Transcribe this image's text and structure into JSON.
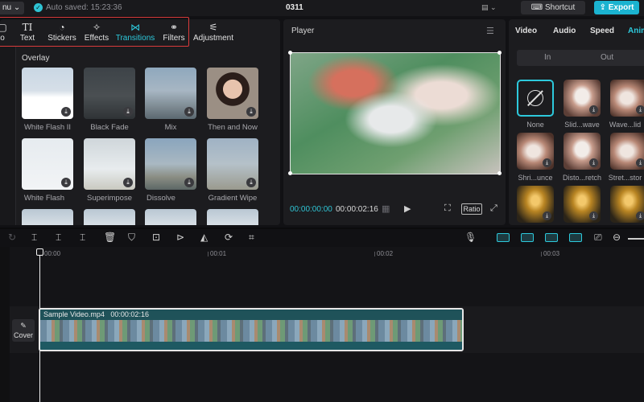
{
  "topbar": {
    "menu_label": "nu ⌄",
    "autosave_text": "Auto saved: 15:23:36",
    "project_title": "0311",
    "shortcut_label": "Shortcut",
    "export_label": "Export"
  },
  "toolbar": {
    "items": [
      {
        "label": "o",
        "icon": "media-icon"
      },
      {
        "label": "Text",
        "icon": "text-icon"
      },
      {
        "label": "Stickers",
        "icon": "sticker-icon"
      },
      {
        "label": "Effects",
        "icon": "effects-icon"
      },
      {
        "label": "Transitions",
        "icon": "transitions-icon",
        "active": true
      },
      {
        "label": "Filters",
        "icon": "filters-icon"
      },
      {
        "label": "Adjustment",
        "icon": "adjustment-icon"
      }
    ],
    "accent_color": "#2dc9dc",
    "highlight_color": "#d93b3b"
  },
  "transitions": {
    "section_label": "Overlay",
    "items": [
      {
        "label": "White Flash II"
      },
      {
        "label": "Black Fade"
      },
      {
        "label": "Mix"
      },
      {
        "label": "Then and Now"
      },
      {
        "label": "White Flash"
      },
      {
        "label": "Superimpose"
      },
      {
        "label": "Dissolve"
      },
      {
        "label": "Gradient Wipe"
      }
    ]
  },
  "player": {
    "title": "Player",
    "current_time": "00:00:00:00",
    "duration": "00:00:02:16",
    "ratio_label": "Ratio"
  },
  "right_panel": {
    "tabs": [
      "Video",
      "Audio",
      "Speed",
      "Anim"
    ],
    "active_tab": "Anim",
    "in_label": "In",
    "out_label": "Out",
    "animations": [
      {
        "label": "None"
      },
      {
        "label": "Slid...wave"
      },
      {
        "label": "Wave...lid"
      },
      {
        "label": "Shri...unce"
      },
      {
        "label": "Disto...retch"
      },
      {
        "label": "Stret...stor"
      }
    ]
  },
  "timeline": {
    "ruler": [
      "00:00",
      "00:01",
      "00:02",
      "00:03"
    ],
    "cover_label": "Cover",
    "clip_name": "Sample Video.mp4",
    "clip_duration": "00:00:02:16"
  }
}
